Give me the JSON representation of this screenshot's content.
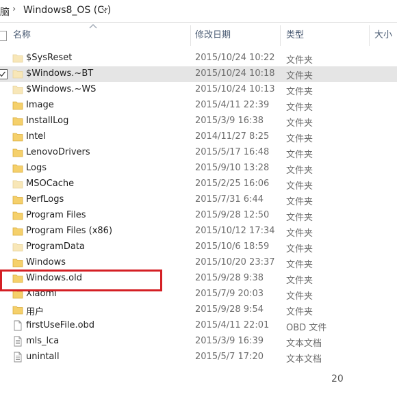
{
  "breadcrumb": {
    "prefix": "脑",
    "separator": "›",
    "drive": "Windows8_OS (C:)"
  },
  "columns": {
    "name": "名称",
    "date": "修改日期",
    "type": "类型",
    "size": "大小"
  },
  "files": [
    {
      "name": "$SysReset",
      "date": "2015/10/24 10:22",
      "type": "文件夹",
      "icon": "folder-icon",
      "faded": true
    },
    {
      "name": "$Windows.~BT",
      "date": "2015/10/24 10:18",
      "type": "文件夹",
      "icon": "folder-icon",
      "faded": true,
      "selected": true
    },
    {
      "name": "$Windows.~WS",
      "date": "2015/10/24 10:13",
      "type": "文件夹",
      "icon": "folder-icon",
      "faded": true
    },
    {
      "name": "Image",
      "date": "2015/4/11 22:39",
      "type": "文件夹",
      "icon": "folder-icon"
    },
    {
      "name": "InstallLog",
      "date": "2015/3/9 16:38",
      "type": "文件夹",
      "icon": "folder-icon"
    },
    {
      "name": "Intel",
      "date": "2014/11/27 8:25",
      "type": "文件夹",
      "icon": "folder-icon"
    },
    {
      "name": "LenovoDrivers",
      "date": "2015/5/17 16:48",
      "type": "文件夹",
      "icon": "folder-icon"
    },
    {
      "name": "Logs",
      "date": "2015/9/10 13:28",
      "type": "文件夹",
      "icon": "folder-icon"
    },
    {
      "name": "MSOCache",
      "date": "2015/2/25 16:06",
      "type": "文件夹",
      "icon": "folder-icon",
      "faded": true
    },
    {
      "name": "PerfLogs",
      "date": "2015/7/31 6:44",
      "type": "文件夹",
      "icon": "folder-icon"
    },
    {
      "name": "Program Files",
      "date": "2015/9/28 12:50",
      "type": "文件夹",
      "icon": "folder-icon"
    },
    {
      "name": "Program Files (x86)",
      "date": "2015/10/12 17:34",
      "type": "文件夹",
      "icon": "folder-icon"
    },
    {
      "name": "ProgramData",
      "date": "2015/10/6 18:59",
      "type": "文件夹",
      "icon": "folder-icon",
      "faded": true
    },
    {
      "name": "Windows",
      "date": "2015/10/20 23:37",
      "type": "文件夹",
      "icon": "folder-icon"
    },
    {
      "name": "Windows.old",
      "date": "2015/9/28 9:38",
      "type": "文件夹",
      "icon": "folder-icon",
      "highlighted": true
    },
    {
      "name": "Xiaomi",
      "date": "2015/7/9 20:03",
      "type": "文件夹",
      "icon": "folder-icon"
    },
    {
      "name": "用户",
      "date": "2015/9/28 9:54",
      "type": "文件夹",
      "icon": "folder-icon"
    },
    {
      "name": "firstUseFile.obd",
      "date": "2015/4/11 22:01",
      "type": "OBD 文件",
      "icon": "file-icon"
    },
    {
      "name": "mls_lca",
      "date": "2015/3/9 16:39",
      "type": "文本文档",
      "icon": "text-document-icon"
    },
    {
      "name": "unintall",
      "date": "2015/5/7 17:20",
      "type": "文本文档",
      "icon": "text-document-icon"
    }
  ],
  "status": {
    "item_count": "20"
  },
  "colors": {
    "folder": "#f5d06b",
    "folder_faded": "#f8e7b8",
    "selection": "#e5e5e5",
    "highlight_box": "#d41f24",
    "header_text": "#4a5b73",
    "meta_text": "#6d6d6d"
  }
}
